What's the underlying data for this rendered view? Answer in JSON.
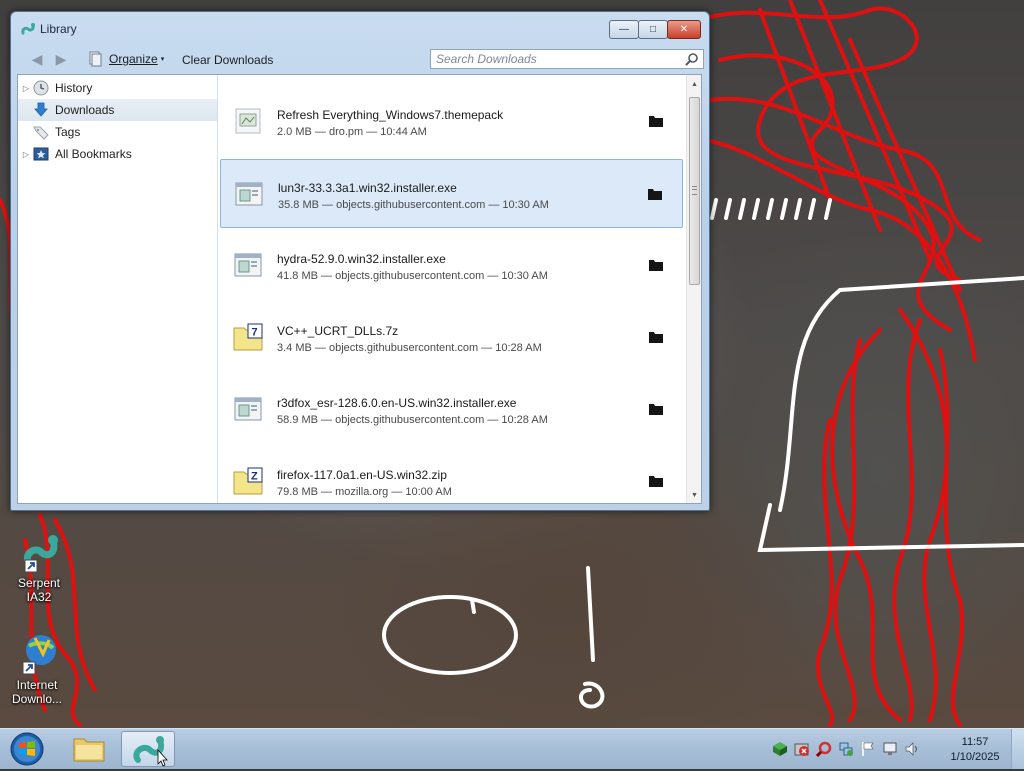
{
  "window": {
    "title": "Library",
    "minimize_glyph": "—",
    "maximize_glyph": "□",
    "close_glyph": "✕"
  },
  "toolbar": {
    "back_glyph": "◀",
    "forward_glyph": "▶",
    "organize_label": "Organize",
    "organize_caret": "▾",
    "clear_downloads_label": "Clear Downloads",
    "search_placeholder": "Search Downloads"
  },
  "sidebar": {
    "items": [
      {
        "label": "History",
        "icon": "clock-icon",
        "expandable": true,
        "selected": false
      },
      {
        "label": "Downloads",
        "icon": "download-arrow-icon",
        "expandable": false,
        "selected": true
      },
      {
        "label": "Tags",
        "icon": "tag-icon",
        "expandable": false,
        "selected": false
      },
      {
        "label": "All Bookmarks",
        "icon": "bookmarks-folder-icon",
        "expandable": true,
        "selected": false
      }
    ]
  },
  "downloads": [
    {
      "name": "Refresh Everything_Windows7.themepack",
      "meta": "2.0 MB — dro.pm — 10:44 AM",
      "icon": "themepack-file-icon",
      "selected": false
    },
    {
      "name": "lun3r-33.3.3a1.win32.installer.exe",
      "meta": "35.8 MB — objects.githubusercontent.com — 10:30 AM",
      "icon": "exe-file-icon",
      "selected": true
    },
    {
      "name": "hydra-52.9.0.win32.installer.exe",
      "meta": "41.8 MB — objects.githubusercontent.com — 10:30 AM",
      "icon": "exe-file-icon",
      "selected": false
    },
    {
      "name": "VC++_UCRT_DLLs.7z",
      "meta": "3.4 MB — objects.githubusercontent.com — 10:28 AM",
      "icon": "7z-archive-icon",
      "selected": false
    },
    {
      "name": "r3dfox_esr-128.6.0.en-US.win32.installer.exe",
      "meta": "58.9 MB — objects.githubusercontent.com — 10:28 AM",
      "icon": "exe-file-icon",
      "selected": false
    },
    {
      "name": "firefox-117.0a1.en-US.win32.zip",
      "meta": "79.8 MB — mozilla.org — 10:00 AM",
      "icon": "zip-archive-icon",
      "selected": false
    }
  ],
  "desktop": {
    "icons": [
      {
        "label": "Serpent IA32",
        "icon": "serpent-browser-icon"
      },
      {
        "label": "Internet Downlo...",
        "icon": "internet-download-manager-icon"
      }
    ]
  },
  "taskbar": {
    "clock_time": "11:57",
    "clock_date": "1/10/2025"
  },
  "colors": {
    "selection_bg": "#dce9f8",
    "selection_border": "#8eb4de",
    "annotation_red": "#e01010",
    "annotation_white": "#ffffff"
  }
}
